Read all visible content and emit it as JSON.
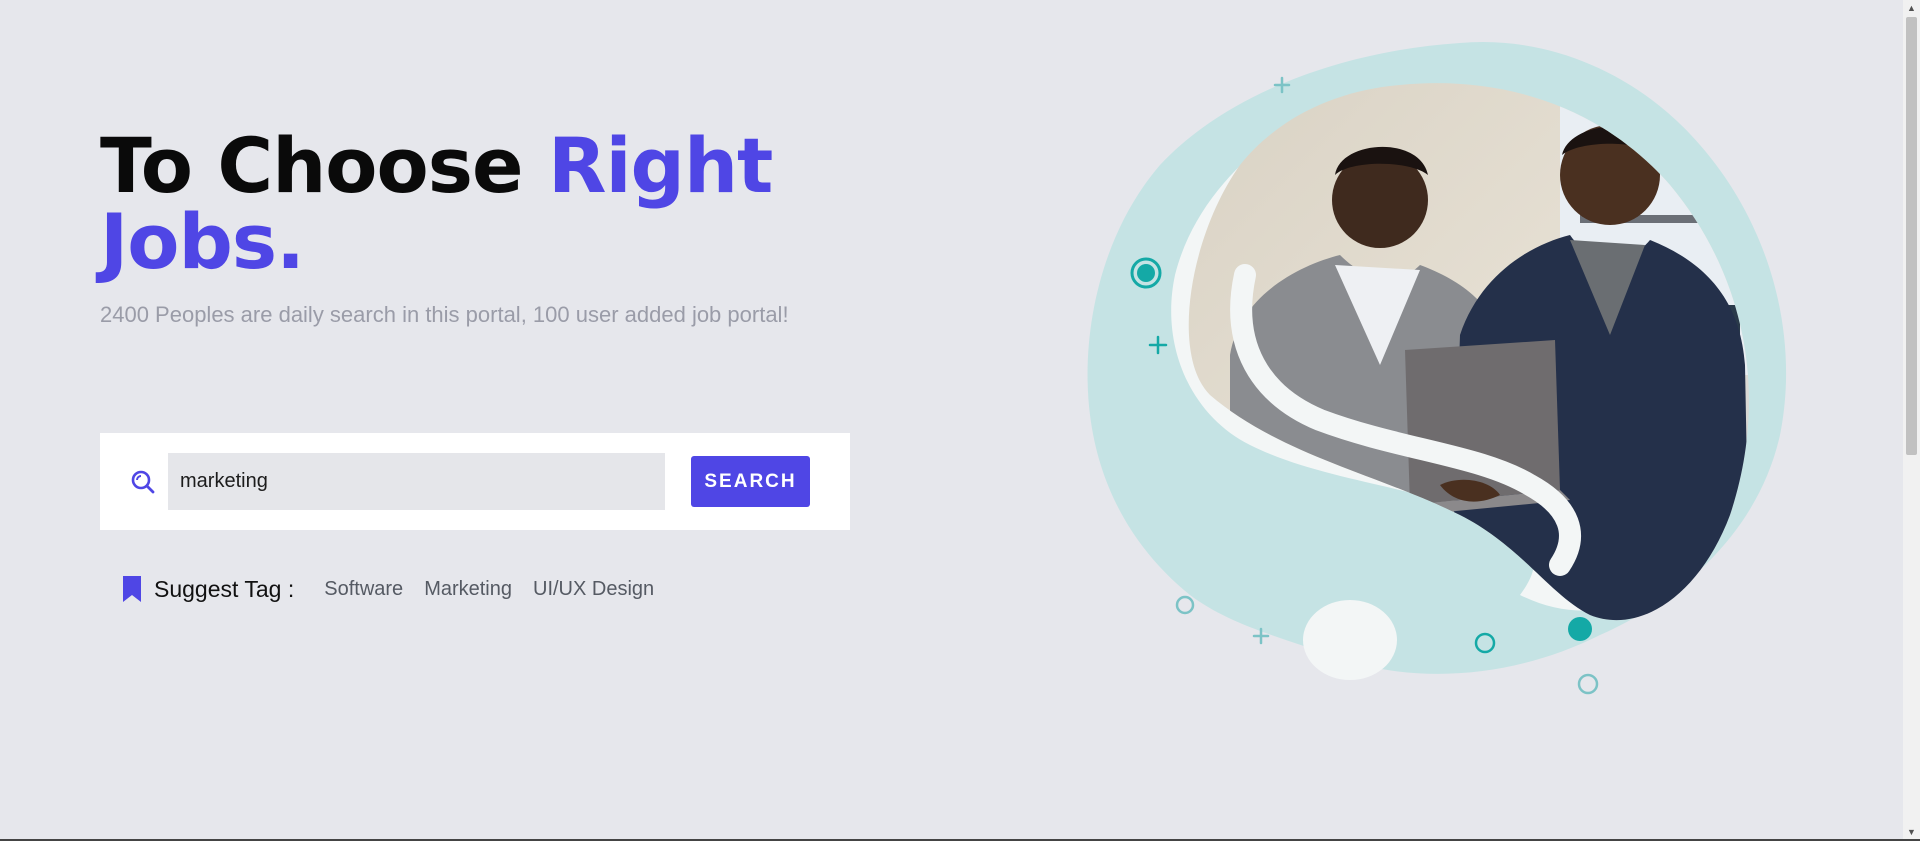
{
  "hero": {
    "title_part1": "To Choose ",
    "title_part2": "Right",
    "title_line2": "Jobs.",
    "subtitle": "2400 Peoples are daily search in this portal, 100 user added job portal!"
  },
  "search": {
    "value": "marketing",
    "button_label": "SEARCH",
    "icon": "search-icon"
  },
  "suggest": {
    "label": "Suggest Tag :",
    "icon": "bookmark-icon",
    "tags": [
      "Software",
      "Marketing",
      "UI/UX Design"
    ]
  },
  "colors": {
    "background": "#e6e7ec",
    "accent": "#4f46e5",
    "teal": "#14a9a6",
    "blob": "#c5e3e4"
  }
}
